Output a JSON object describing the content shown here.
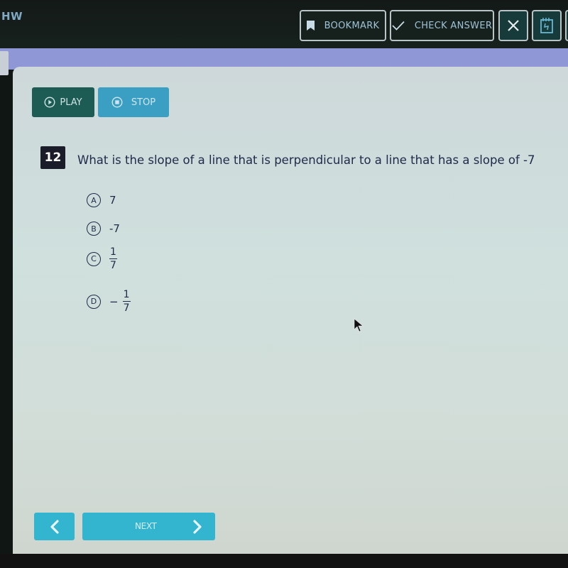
{
  "header": {
    "app_title": "HW",
    "bookmark_label": "BOOKMARK",
    "check_answer_label": "CHECK ANSWER",
    "close_icon": "close-icon",
    "notepad_icon": "notepad-icon"
  },
  "audio": {
    "play_label": "PLAY",
    "stop_label": "STOP"
  },
  "question": {
    "number": "12",
    "text": "What is the slope of a line that is perpendicular to a line that has a slope of -7",
    "options": [
      {
        "letter": "A",
        "value": "7"
      },
      {
        "letter": "B",
        "value": "-7"
      },
      {
        "letter": "C",
        "numerator": "1",
        "denominator": "7",
        "sign": ""
      },
      {
        "letter": "D",
        "numerator": "1",
        "denominator": "7",
        "sign": "−"
      }
    ]
  },
  "navigation": {
    "prev_icon": "chevron-left-icon",
    "next_label": "NEXT",
    "next_icon": "chevron-right-icon"
  },
  "colors": {
    "header_bg": "#141917",
    "band": "#8f97d6",
    "play": "#1d5b55",
    "stop": "#3a9fc2",
    "nav": "#33b4cf",
    "question_number_bg": "#1b1c2a",
    "text": "#1e2a4a"
  }
}
